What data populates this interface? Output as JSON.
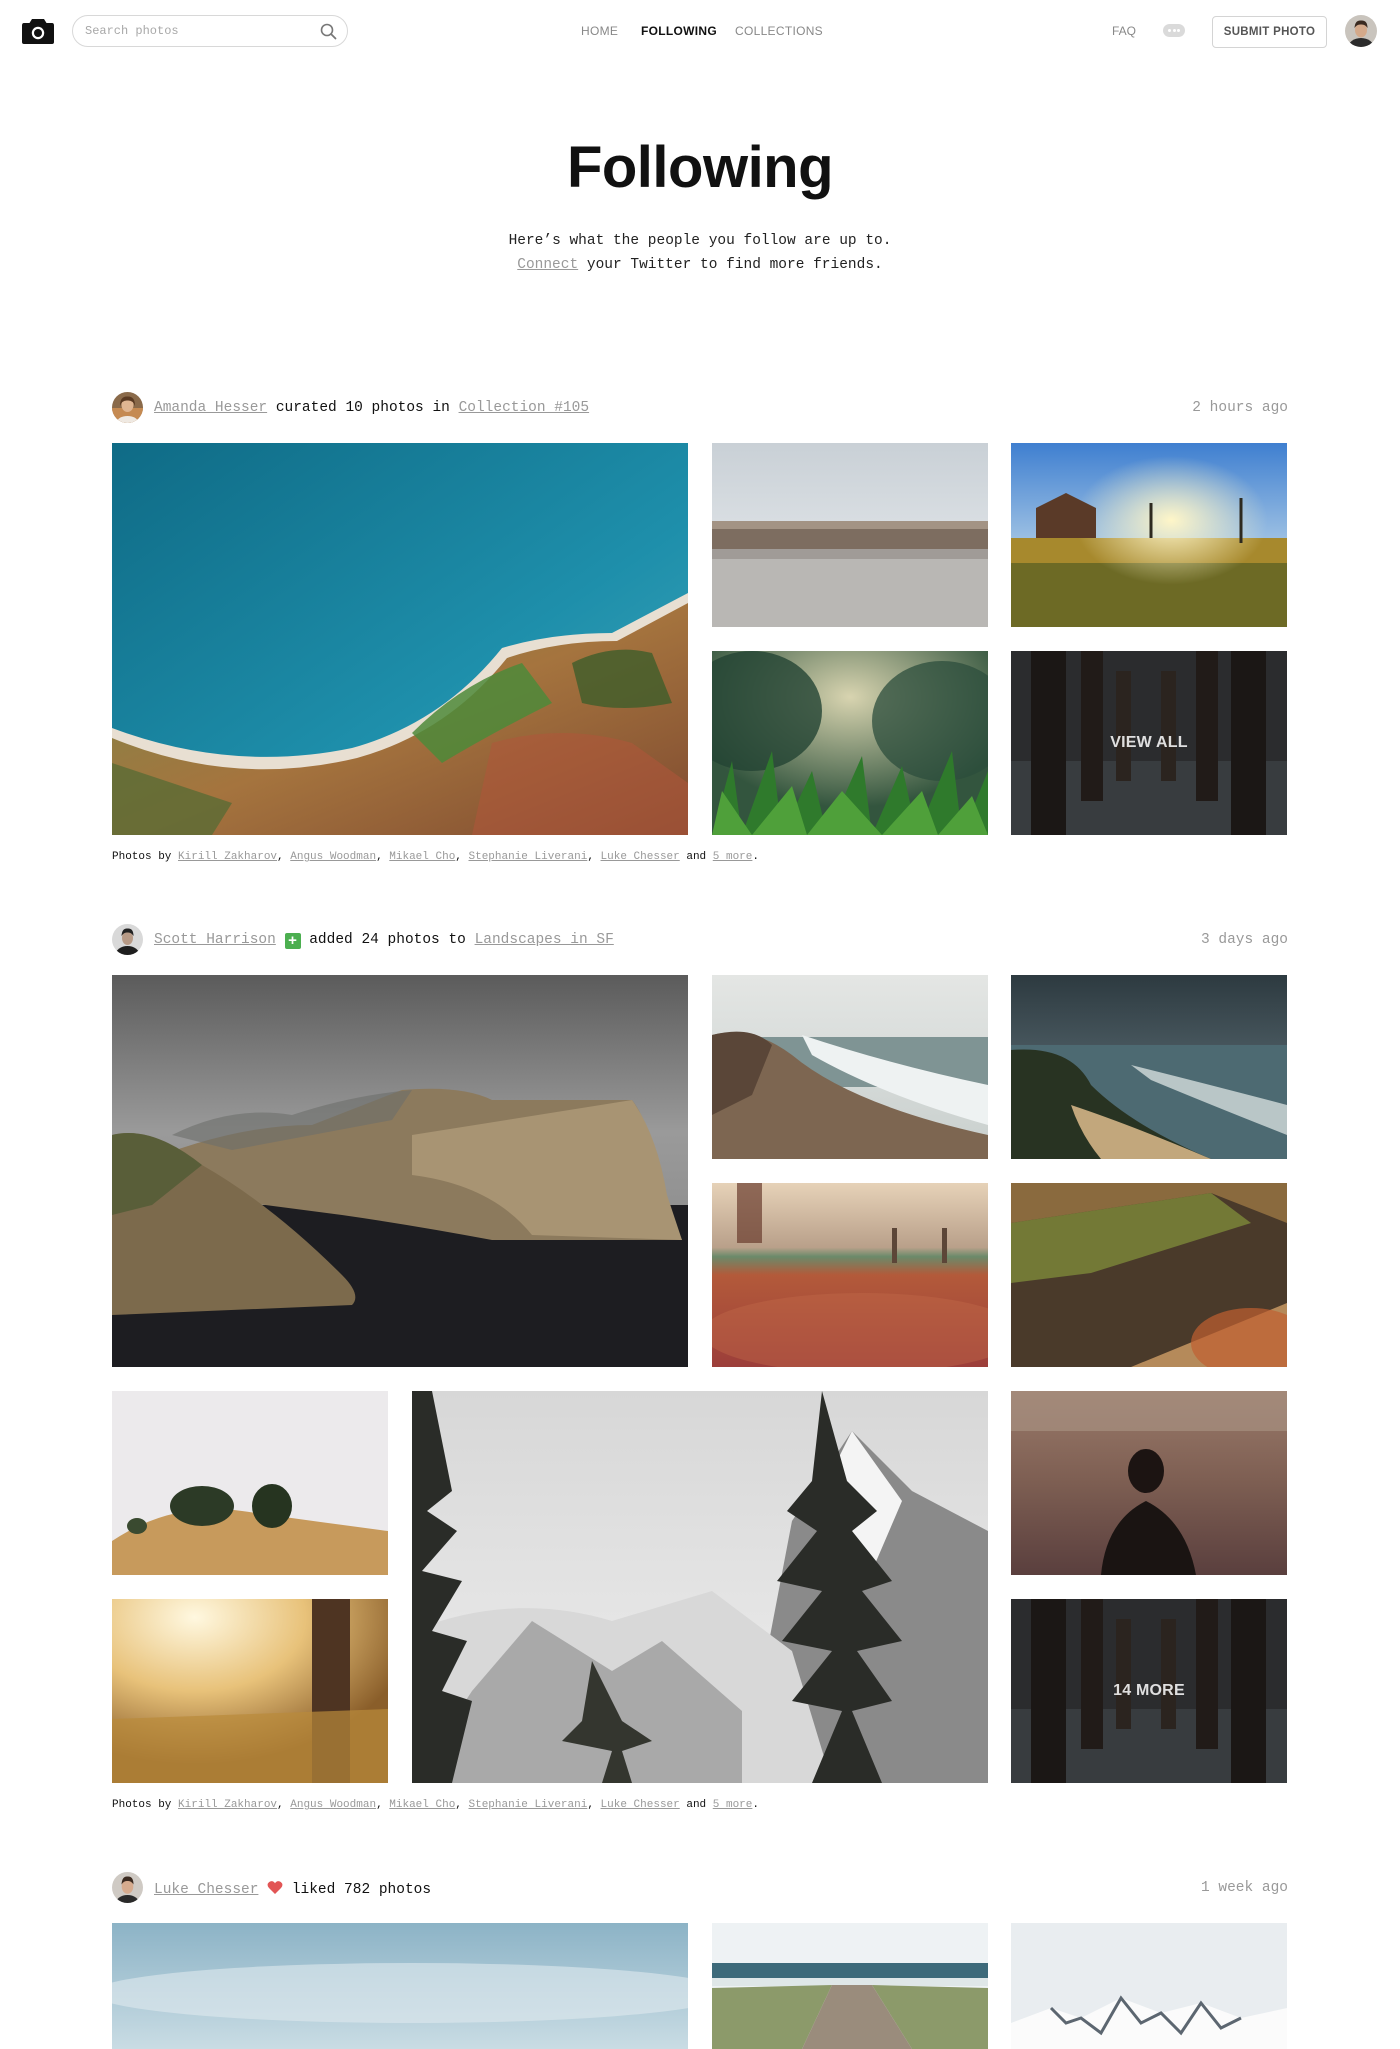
{
  "nav": {
    "search_placeholder": "Search photos",
    "links": [
      "HOME",
      "FOLLOWING",
      "COLLECTIONS"
    ],
    "active_link": "FOLLOWING",
    "faq": "FAQ",
    "submit": "SUBMIT PHOTO"
  },
  "hero": {
    "title": "Following",
    "line1": "Here’s what the people you follow are up to.",
    "connect": "Connect",
    "line2_rest": " your Twitter to find more friends."
  },
  "feed": [
    {
      "user": "Amanda Hesser",
      "action": " curated 10 photos in ",
      "target": "Collection #105",
      "time": "2 hours ago",
      "overlay": "VIEW ALL",
      "credits_prefix": "Photos by ",
      "credits": [
        "Kirill Zakharov",
        "Angus Woodman",
        "Mikael Cho",
        "Stephanie Liverani",
        "Luke Chesser"
      ],
      "credits_and": " and ",
      "credits_more": "5 more",
      "credits_end": "."
    },
    {
      "user": "Scott Harrison",
      "badge": "+",
      "action": " added 24 photos to ",
      "target": "Landscapes in SF",
      "time": "3 days ago",
      "overlay": "14 MORE",
      "credits_prefix": "Photos by ",
      "credits": [
        "Kirill Zakharov",
        "Angus Woodman",
        "Mikael Cho",
        "Stephanie Liverani",
        "Luke Chesser"
      ],
      "credits_and": " and ",
      "credits_more": "5 more",
      "credits_end": "."
    },
    {
      "user": "Luke Chesser",
      "badge": "heart-icon",
      "action": " liked 782 photos",
      "time": "1 week ago"
    }
  ],
  "colors": {
    "badge_green": "#4caf50",
    "heart_red": "#e25555",
    "link_gray": "#999999"
  }
}
